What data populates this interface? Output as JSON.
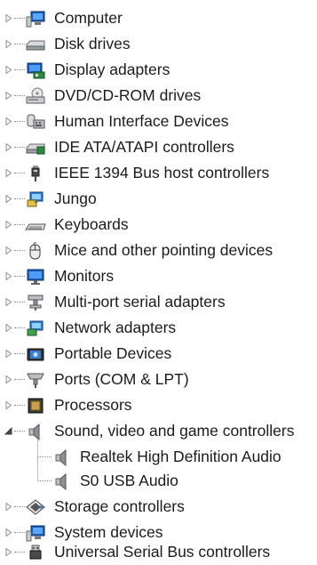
{
  "tree": {
    "items": [
      {
        "label": "Computer",
        "icon": "computer-icon"
      },
      {
        "label": "Disk drives",
        "icon": "disk-drive-icon"
      },
      {
        "label": "Display adapters",
        "icon": "display-adapter-icon"
      },
      {
        "label": "DVD/CD-ROM drives",
        "icon": "dvd-drive-icon"
      },
      {
        "label": "Human Interface Devices",
        "icon": "hid-icon"
      },
      {
        "label": "IDE ATA/ATAPI controllers",
        "icon": "ide-controller-icon"
      },
      {
        "label": "IEEE 1394 Bus host controllers",
        "icon": "ieee1394-icon"
      },
      {
        "label": "Jungo",
        "icon": "jungo-icon"
      },
      {
        "label": "Keyboards",
        "icon": "keyboard-icon"
      },
      {
        "label": "Mice and other pointing devices",
        "icon": "mouse-icon"
      },
      {
        "label": "Monitors",
        "icon": "monitor-icon"
      },
      {
        "label": "Multi-port serial adapters",
        "icon": "multiport-serial-icon"
      },
      {
        "label": "Network adapters",
        "icon": "network-adapter-icon"
      },
      {
        "label": "Portable Devices",
        "icon": "portable-device-icon"
      },
      {
        "label": "Ports (COM & LPT)",
        "icon": "port-icon"
      },
      {
        "label": "Processors",
        "icon": "processor-icon"
      },
      {
        "label": "Sound, video and game controllers",
        "icon": "speaker-icon",
        "expanded": true,
        "children": [
          {
            "label": "Realtek High Definition Audio",
            "icon": "speaker-icon"
          },
          {
            "label": "S0 USB Audio",
            "icon": "speaker-icon"
          }
        ]
      },
      {
        "label": "Storage controllers",
        "icon": "storage-controller-icon"
      },
      {
        "label": "System devices",
        "icon": "system-device-icon"
      },
      {
        "label": "Universal Serial Bus controllers",
        "icon": "usb-icon"
      }
    ]
  }
}
